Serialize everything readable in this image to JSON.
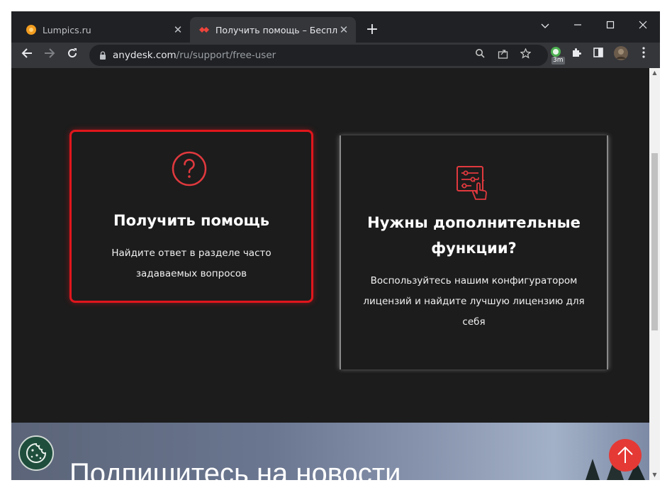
{
  "browser": {
    "tabs": [
      {
        "title": "Lumpics.ru",
        "favicon": "lumpics-orange-circle",
        "active": false
      },
      {
        "title": "Получить помощь – Бесплатны",
        "favicon": "anydesk-red-diamond",
        "active": true
      }
    ],
    "new_tab_label": "+",
    "url_host": "anydesk.com",
    "url_path": "/ru/support/free-user",
    "extension_badge": "3m"
  },
  "cards": [
    {
      "icon": "question-circle-icon",
      "title": "Получить помощь",
      "description": "Найдите ответ в разделе часто задаваемых вопросов",
      "highlighted": true
    },
    {
      "icon": "configurator-touch-icon",
      "title": "Нужны дополнительные функции?",
      "description": "Воспользуйтесь нашим конфигуратором лицензий и найдите лучшую лицензию для себя",
      "highlighted": false
    }
  ],
  "banner": {
    "heading": "Подпишитесь на новости"
  },
  "colors": {
    "accent": "#e0161c",
    "page_bg": "#1c1c1c",
    "icon_red": "#e0393e",
    "cookie_button": "#1f4e3d",
    "scroll_top_button": "#e53935"
  }
}
